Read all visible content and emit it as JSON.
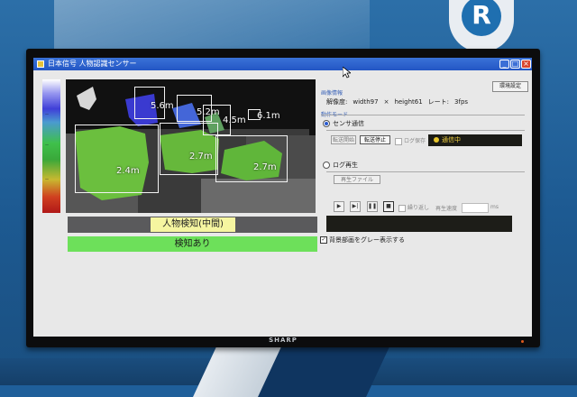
{
  "window": {
    "title": "日本信号 人物認識センサー"
  },
  "toolbar": {
    "env_settings_label": "環境設定"
  },
  "image_info": {
    "section_label": "画像情報",
    "resolution_label": "解像度:",
    "width_text": "width97",
    "times": "×",
    "height_text": "height61",
    "rate_label": "レート:",
    "fps_text": "3fps"
  },
  "mode": {
    "section_label": "動作モード",
    "sensor_label": "センサ通信",
    "sensor_selected": true,
    "start_label": "転送開始",
    "stop_label": "転送停止",
    "log_save_label": "ログ保存",
    "status_text": "通信中",
    "log_play_label": "ログ再生",
    "play_file_label": "再生ファイル",
    "repeat_label": "繰り返し",
    "speed_label": "再生速度",
    "speed_unit": "ms"
  },
  "detection": {
    "distances": [
      "5.6m",
      "5.2m",
      "4.5m",
      "6.1m",
      "2.4m",
      "2.7m",
      "2.7m"
    ],
    "person_label": "人物検知(中間)",
    "status_label": "検知あり",
    "gray_background_label": "背景部画をグレー表示する",
    "gray_background_checked": true
  },
  "colors": {
    "detect_green": "#6de05a",
    "person_yellow": "#f5f5a0",
    "title_blue": "#2356c4"
  },
  "device": {
    "brand": "SHARP"
  }
}
